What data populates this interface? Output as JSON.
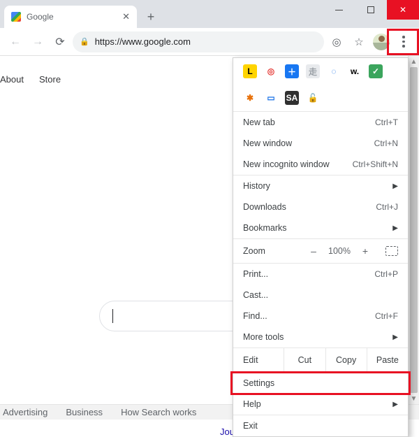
{
  "window": {
    "tab_title": "Google",
    "min_tooltip": "Minimize",
    "max_tooltip": "Maximize",
    "close_tooltip": "Close",
    "new_tab": "+"
  },
  "toolbar": {
    "url": "https://www.google.com",
    "back": "←",
    "forward": "→",
    "reload": "⟳",
    "target": "◎",
    "star": "☆"
  },
  "page": {
    "about": "About",
    "store": "Store",
    "journal": "Journ",
    "footer": {
      "advertising": "Advertising",
      "business": "Business",
      "how": "How Search works"
    }
  },
  "extensions": [
    {
      "bg": "#ffd400",
      "fg": "#000",
      "txt": "L"
    },
    {
      "bg": "#ffffff",
      "fg": "#e53935",
      "txt": "◎"
    },
    {
      "bg": "#1877f2",
      "fg": "#fff",
      "txt": "＋"
    },
    {
      "bg": "#e8eaed",
      "fg": "#9aa0a6",
      "txt": "走"
    },
    {
      "bg": "#ffffff",
      "fg": "#1a73e8",
      "txt": "◌"
    },
    {
      "bg": "#ffffff",
      "fg": "#000",
      "txt": "w."
    },
    {
      "bg": "#3ba55d",
      "fg": "#fff",
      "txt": "✓"
    },
    {
      "bg": "#ffffff",
      "fg": "#e8710a",
      "txt": "✱"
    },
    {
      "bg": "#ffffff",
      "fg": "#1a73e8",
      "txt": "▭"
    },
    {
      "bg": "#303030",
      "fg": "#fff",
      "txt": "SA"
    },
    {
      "bg": "#ffffff",
      "fg": "#9aa0a6",
      "txt": "🔓"
    }
  ],
  "menu": {
    "new_tab": {
      "label": "New tab",
      "shortcut": "Ctrl+T"
    },
    "new_window": {
      "label": "New window",
      "shortcut": "Ctrl+N"
    },
    "incognito": {
      "label": "New incognito window",
      "shortcut": "Ctrl+Shift+N"
    },
    "history": {
      "label": "History"
    },
    "downloads": {
      "label": "Downloads",
      "shortcut": "Ctrl+J"
    },
    "bookmarks": {
      "label": "Bookmarks"
    },
    "zoom": {
      "label": "Zoom",
      "level": "100%",
      "minus": "–",
      "plus": "+"
    },
    "print": {
      "label": "Print...",
      "shortcut": "Ctrl+P"
    },
    "cast": {
      "label": "Cast..."
    },
    "find": {
      "label": "Find...",
      "shortcut": "Ctrl+F"
    },
    "more_tools": {
      "label": "More tools"
    },
    "edit": {
      "label": "Edit",
      "cut": "Cut",
      "copy": "Copy",
      "paste": "Paste"
    },
    "settings": {
      "label": "Settings"
    },
    "help": {
      "label": "Help"
    },
    "exit": {
      "label": "Exit"
    }
  }
}
